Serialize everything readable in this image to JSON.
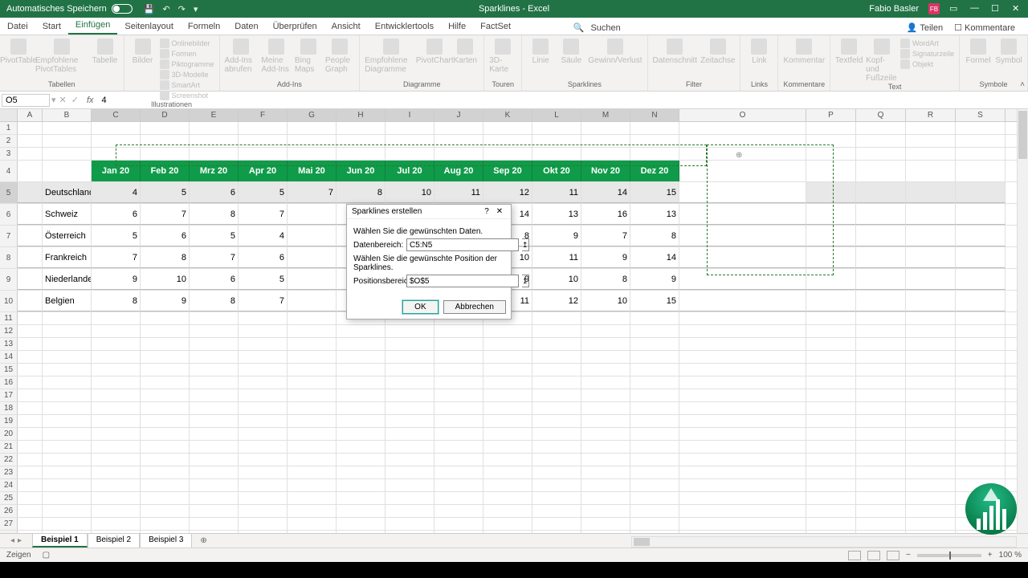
{
  "title": {
    "autosave": "Automatisches Speichern",
    "doc": "Sparklines",
    "app": "Excel",
    "user": "Fabio Basler",
    "initials": "FB"
  },
  "tabs": {
    "items": [
      "Datei",
      "Start",
      "Einfügen",
      "Seitenlayout",
      "Formeln",
      "Daten",
      "Überprüfen",
      "Ansicht",
      "Entwicklertools",
      "Hilfe",
      "FactSet"
    ],
    "active": 2,
    "search": "Suchen",
    "share": "Teilen",
    "comments": "Kommentare"
  },
  "ribbon": {
    "groups": [
      {
        "label": "Tabellen",
        "buttons": [
          "PivotTable",
          "Empfohlene PivotTables",
          "Tabelle"
        ]
      },
      {
        "label": "Illustrationen",
        "buttons": [
          "Bilder"
        ],
        "small": [
          "Onlinebilder",
          "Formen",
          "Piktogramme",
          "3D-Modelle",
          "SmartArt",
          "Screenshot"
        ]
      },
      {
        "label": "Add-Ins",
        "buttons": [
          "Add-Ins abrufen",
          "Meine Add-Ins",
          "Bing Maps",
          "People Graph"
        ]
      },
      {
        "label": "Diagramme",
        "buttons": [
          "Empfohlene Diagramme",
          "PivotChart",
          "Karten"
        ]
      },
      {
        "label": "Touren",
        "buttons": [
          "3D-Karte"
        ]
      },
      {
        "label": "Sparklines",
        "buttons": [
          "Linie",
          "Säule",
          "Gewinn/Verlust"
        ]
      },
      {
        "label": "Filter",
        "buttons": [
          "Datenschnitt",
          "Zeitachse"
        ]
      },
      {
        "label": "Links",
        "buttons": [
          "Link"
        ]
      },
      {
        "label": "Kommentare",
        "buttons": [
          "Kommentar"
        ]
      },
      {
        "label": "Text",
        "buttons": [
          "Textfeld",
          "Kopf- und Fußzeile"
        ],
        "small": [
          "WordArt",
          "Signaturzeile",
          "Objekt"
        ]
      },
      {
        "label": "Symbole",
        "buttons": [
          "Formel",
          "Symbol"
        ]
      }
    ]
  },
  "fbar": {
    "name": "O5",
    "formula": "4"
  },
  "columns": [
    {
      "l": "A",
      "w": 31
    },
    {
      "l": "B",
      "w": 61
    },
    {
      "l": "C",
      "w": 61
    },
    {
      "l": "D",
      "w": 61
    },
    {
      "l": "E",
      "w": 61
    },
    {
      "l": "F",
      "w": 61
    },
    {
      "l": "G",
      "w": 61
    },
    {
      "l": "H",
      "w": 61
    },
    {
      "l": "I",
      "w": 61
    },
    {
      "l": "J",
      "w": 61
    },
    {
      "l": "K",
      "w": 61
    },
    {
      "l": "L",
      "w": 61
    },
    {
      "l": "M",
      "w": 61
    },
    {
      "l": "N",
      "w": 61
    },
    {
      "l": "O",
      "w": 158
    },
    {
      "l": "P",
      "w": 62
    },
    {
      "l": "Q",
      "w": 62
    },
    {
      "l": "R",
      "w": 62
    },
    {
      "l": "S",
      "w": 62
    }
  ],
  "header_row": [
    "",
    "",
    "Jan 20",
    "Feb 20",
    "Mrz 20",
    "Apr 20",
    "Mai 20",
    "Jun 20",
    "Jul 20",
    "Aug 20",
    "Sep 20",
    "Okt 20",
    "Nov 20",
    "Dez 20",
    "",
    "",
    "",
    "",
    ""
  ],
  "data_rows": [
    {
      "r": 5,
      "cells": [
        "",
        "Deutschland",
        "4",
        "5",
        "6",
        "5",
        "7",
        "8",
        "10",
        "11",
        "12",
        "11",
        "14",
        "15",
        "",
        "",
        "",
        "",
        ""
      ]
    },
    {
      "r": 6,
      "cells": [
        "",
        "Schweiz",
        "6",
        "7",
        "8",
        "7",
        "",
        "",
        "",
        "",
        "14",
        "13",
        "16",
        "13",
        "",
        "",
        "",
        "",
        ""
      ]
    },
    {
      "r": 7,
      "cells": [
        "",
        "Österreich",
        "5",
        "6",
        "5",
        "4",
        "",
        "",
        "",
        "",
        "8",
        "9",
        "7",
        "8",
        "",
        "",
        "",
        "",
        ""
      ]
    },
    {
      "r": 8,
      "cells": [
        "",
        "Frankreich",
        "7",
        "8",
        "7",
        "6",
        "",
        "",
        "",
        "",
        "10",
        "11",
        "9",
        "14",
        "",
        "",
        "",
        "",
        ""
      ]
    },
    {
      "r": 9,
      "cells": [
        "",
        "Niederlande",
        "9",
        "10",
        "6",
        "5",
        "",
        "",
        "",
        "",
        "9",
        "10",
        "8",
        "9",
        "",
        "",
        "",
        "",
        ""
      ]
    },
    {
      "r": 10,
      "cells": [
        "",
        "Belgien",
        "8",
        "9",
        "8",
        "7",
        "",
        "",
        "",
        "",
        "11",
        "12",
        "10",
        "15",
        "",
        "",
        "",
        "",
        ""
      ]
    }
  ],
  "dialog": {
    "title": "Sparklines erstellen",
    "line1": "Wählen Sie die gewünschten Daten.",
    "field1_label": "Datenbereich:",
    "field1_value": "C5:N5",
    "line2": "Wählen Sie die gewünschte Position der Sparklines.",
    "field2_label": "Positionsbereich:",
    "field2_value": "$O$5",
    "ok": "OK",
    "cancel": "Abbrechen"
  },
  "sheets": {
    "items": [
      "Beispiel 1",
      "Beispiel 2",
      "Beispiel 3"
    ],
    "active": 0
  },
  "status": {
    "mode": "Zeigen",
    "zoom": "100 %"
  }
}
